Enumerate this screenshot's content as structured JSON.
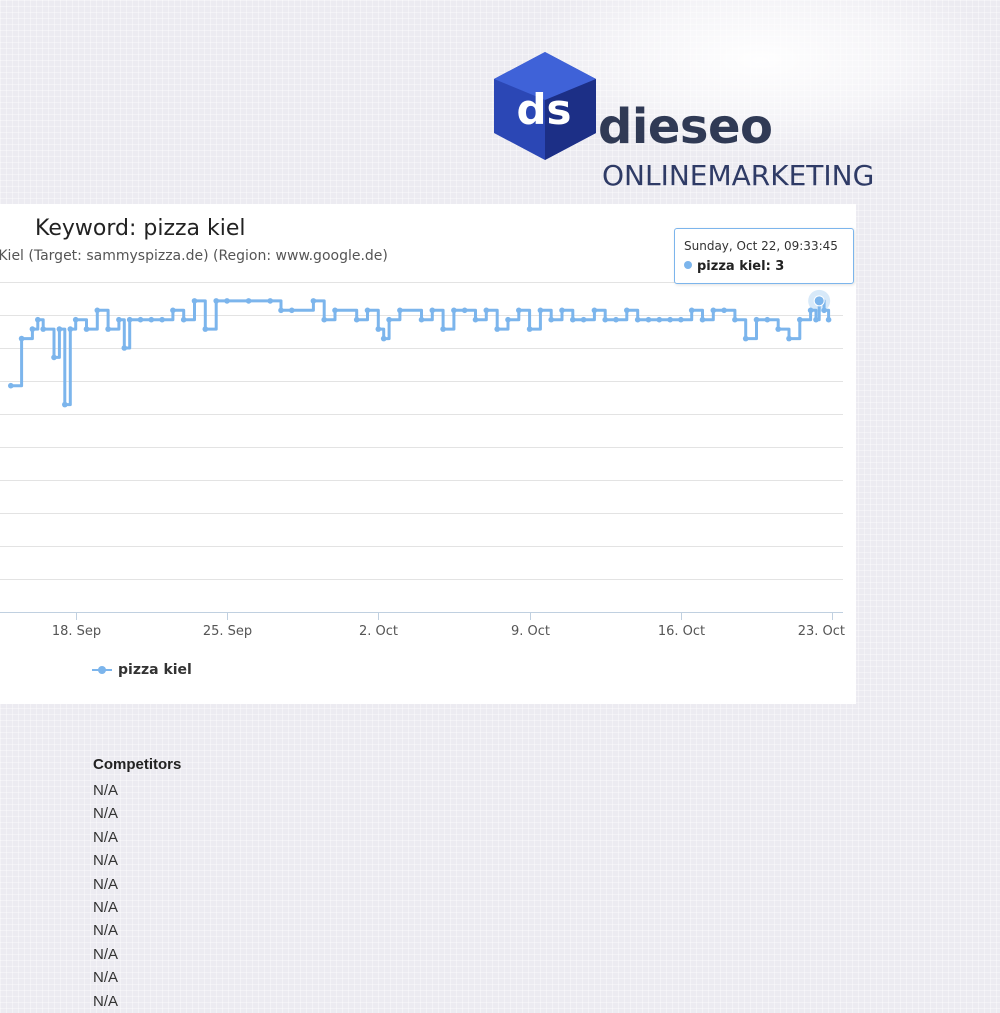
{
  "brand": {
    "mark_text": "ds",
    "name": "dieseo",
    "tagline": "ONLINEMARKETING",
    "colors": {
      "mark": "#2b47b5",
      "mark_dark": "#1c2f86",
      "mark_light": "#3f62d8",
      "text": "#303a55"
    }
  },
  "chart_data": {
    "type": "line",
    "title": "Keyword: pizza kiel",
    "subtitle": "za Kiel (Target: sammyspizza.de) (Region: www.google.de)",
    "x_ticks": [
      "18. Sep",
      "25. Sep",
      "2. Oct",
      "9. Oct",
      "16. Oct",
      "23. Oct"
    ],
    "series": [
      {
        "name": "pizza kiel",
        "color": "#7cb5ec",
        "points": [
          [
            "2017-09-15",
            12
          ],
          [
            "2017-09-15 12:00",
            7
          ],
          [
            "2017-09-16",
            6
          ],
          [
            "2017-09-16 06:00",
            5
          ],
          [
            "2017-09-16 12:00",
            6
          ],
          [
            "2017-09-17",
            9
          ],
          [
            "2017-09-17 06:00",
            6
          ],
          [
            "2017-09-17 12:00",
            14
          ],
          [
            "2017-09-17 18:00",
            6
          ],
          [
            "2017-09-18",
            5
          ],
          [
            "2017-09-18 12:00",
            6
          ],
          [
            "2017-09-19",
            4
          ],
          [
            "2017-09-19 12:00",
            6
          ],
          [
            "2017-09-20",
            5
          ],
          [
            "2017-09-20 06:00",
            8
          ],
          [
            "2017-09-20 12:00",
            5
          ],
          [
            "2017-09-21",
            5
          ],
          [
            "2017-09-21 12:00",
            5
          ],
          [
            "2017-09-22",
            5
          ],
          [
            "2017-09-22 12:00",
            4
          ],
          [
            "2017-09-23",
            5
          ],
          [
            "2017-09-23 12:00",
            3
          ],
          [
            "2017-09-24",
            6
          ],
          [
            "2017-09-24 12:00",
            3
          ],
          [
            "2017-09-25",
            3
          ],
          [
            "2017-09-26",
            3
          ],
          [
            "2017-09-27",
            3
          ],
          [
            "2017-09-27 12:00",
            4
          ],
          [
            "2017-09-28",
            4
          ],
          [
            "2017-09-29",
            3
          ],
          [
            "2017-09-29 12:00",
            5
          ],
          [
            "2017-09-30",
            4
          ],
          [
            "2017-10-01",
            5
          ],
          [
            "2017-10-01 12:00",
            4
          ],
          [
            "2017-10-02",
            6
          ],
          [
            "2017-10-02 06:00",
            7
          ],
          [
            "2017-10-02 12:00",
            5
          ],
          [
            "2017-10-03",
            4
          ],
          [
            "2017-10-04",
            5
          ],
          [
            "2017-10-04 12:00",
            4
          ],
          [
            "2017-10-05",
            6
          ],
          [
            "2017-10-05 12:00",
            4
          ],
          [
            "2017-10-06",
            4
          ],
          [
            "2017-10-06 12:00",
            5
          ],
          [
            "2017-10-07",
            4
          ],
          [
            "2017-10-07 12:00",
            6
          ],
          [
            "2017-10-08",
            5
          ],
          [
            "2017-10-08 12:00",
            4
          ],
          [
            "2017-10-09",
            6
          ],
          [
            "2017-10-09 12:00",
            4
          ],
          [
            "2017-10-10",
            5
          ],
          [
            "2017-10-10 12:00",
            4
          ],
          [
            "2017-10-11",
            5
          ],
          [
            "2017-10-11 12:00",
            5
          ],
          [
            "2017-10-12",
            4
          ],
          [
            "2017-10-12 12:00",
            5
          ],
          [
            "2017-10-13",
            5
          ],
          [
            "2017-10-13 12:00",
            4
          ],
          [
            "2017-10-14",
            5
          ],
          [
            "2017-10-14 12:00",
            5
          ],
          [
            "2017-10-15",
            5
          ],
          [
            "2017-10-15 12:00",
            5
          ],
          [
            "2017-10-16",
            5
          ],
          [
            "2017-10-16 12:00",
            4
          ],
          [
            "2017-10-17",
            5
          ],
          [
            "2017-10-17 12:00",
            4
          ],
          [
            "2017-10-18",
            4
          ],
          [
            "2017-10-18 12:00",
            5
          ],
          [
            "2017-10-19",
            7
          ],
          [
            "2017-10-19 12:00",
            5
          ],
          [
            "2017-10-20",
            5
          ],
          [
            "2017-10-20 12:00",
            6
          ],
          [
            "2017-10-21",
            7
          ],
          [
            "2017-10-21 12:00",
            5
          ],
          [
            "2017-10-22",
            4
          ],
          [
            "2017-10-22 06:00",
            5
          ],
          [
            "2017-10-22 09:33",
            3
          ],
          [
            "2017-10-22 15:00",
            4
          ],
          [
            "2017-10-22 20:00",
            5
          ]
        ]
      }
    ],
    "x_axis": {
      "type": "datetime",
      "range": [
        "2017-09-14 12:00",
        "2017-10-23 12:00"
      ]
    },
    "y_axis": {
      "reversed": true,
      "range": [
        1,
        36
      ],
      "gridlines": 11,
      "tick_labels_visible": false
    },
    "grid": true,
    "legend_position": "bottom-left",
    "tooltip": {
      "date": "Sunday, Oct 22, 09:33:45",
      "series": "pizza kiel",
      "value": "3",
      "text": "pizza kiel: 3"
    }
  },
  "competitors": {
    "heading": "Competitors",
    "items": [
      "N/A",
      "N/A",
      "N/A",
      "N/A",
      "N/A",
      "N/A",
      "N/A",
      "N/A",
      "N/A",
      "N/A"
    ]
  }
}
